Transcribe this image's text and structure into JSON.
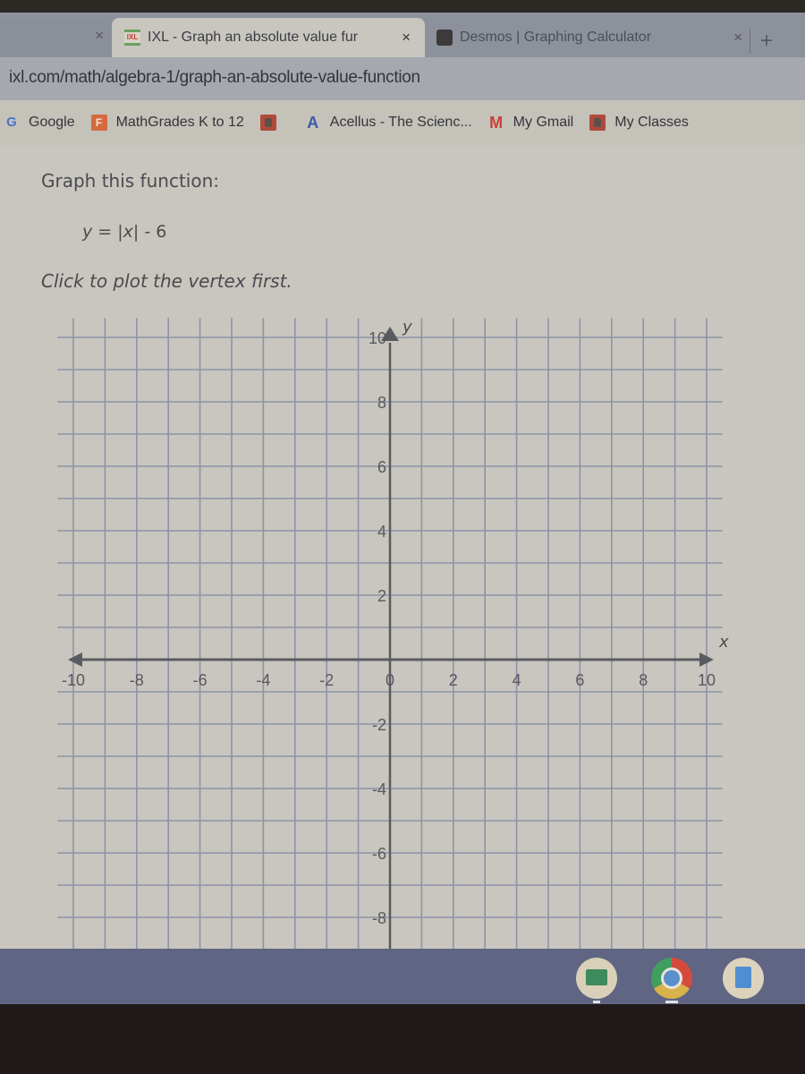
{
  "browser": {
    "tabs": [
      {
        "title": "",
        "close": "×",
        "active": false,
        "favicon": "blank"
      },
      {
        "title": "IXL - Graph an absolute value fur",
        "close": "×",
        "active": true,
        "favicon": "ixl-icon"
      },
      {
        "title": "Desmos | Graphing Calculator",
        "close": "×",
        "active": false,
        "favicon": "desmos-icon"
      }
    ],
    "new_tab": "+",
    "url": "ixl.com/math/algebra-1/graph-an-absolute-value-function",
    "bookmarks": [
      {
        "label": "Google",
        "icon": "google-icon",
        "glyph": "G"
      },
      {
        "label": "MathGrades K to 12",
        "icon": "mathgrades-icon",
        "glyph": "F"
      },
      {
        "label": "",
        "icon": "classroom-icon",
        "glyph": ""
      },
      {
        "label": "Acellus - The Scienc...",
        "icon": "acellus-icon",
        "glyph": "A"
      },
      {
        "label": "My Gmail",
        "icon": "gmail-icon",
        "glyph": "M"
      },
      {
        "label": "My Classes",
        "icon": "classroom-icon",
        "glyph": ""
      }
    ]
  },
  "question": {
    "prompt": "Graph this function:",
    "equation_y": "y",
    "equation_rest": " = |",
    "equation_x": "x",
    "equation_tail": "| - 6",
    "instruction": "Click to plot the vertex first."
  },
  "chart_data": {
    "type": "scatter",
    "title": "",
    "xlabel": "x",
    "ylabel": "y",
    "xlim": [
      -10,
      10
    ],
    "ylim": [
      -10,
      10
    ],
    "grid": true,
    "x_ticks": [
      -10,
      -8,
      -6,
      -4,
      -2,
      0,
      2,
      4,
      6,
      8,
      10
    ],
    "y_ticks": [
      10,
      8,
      6,
      4,
      2,
      -2,
      -4,
      -6,
      -8
    ],
    "x_tick_labels": [
      "-10",
      "-8",
      "-6",
      "-4",
      "-2",
      "0",
      "2",
      "4",
      "6",
      "8",
      "10"
    ],
    "y_tick_labels": [
      "10",
      "8",
      "6",
      "4",
      "2",
      "-2",
      "-4",
      "-6",
      "-8"
    ],
    "points": []
  },
  "shelf": {
    "apps": [
      {
        "name": "Google Classroom",
        "icon": "classroom-icon"
      },
      {
        "name": "Chrome",
        "icon": "chrome-icon"
      },
      {
        "name": "Google Docs",
        "icon": "docs-icon"
      }
    ]
  }
}
